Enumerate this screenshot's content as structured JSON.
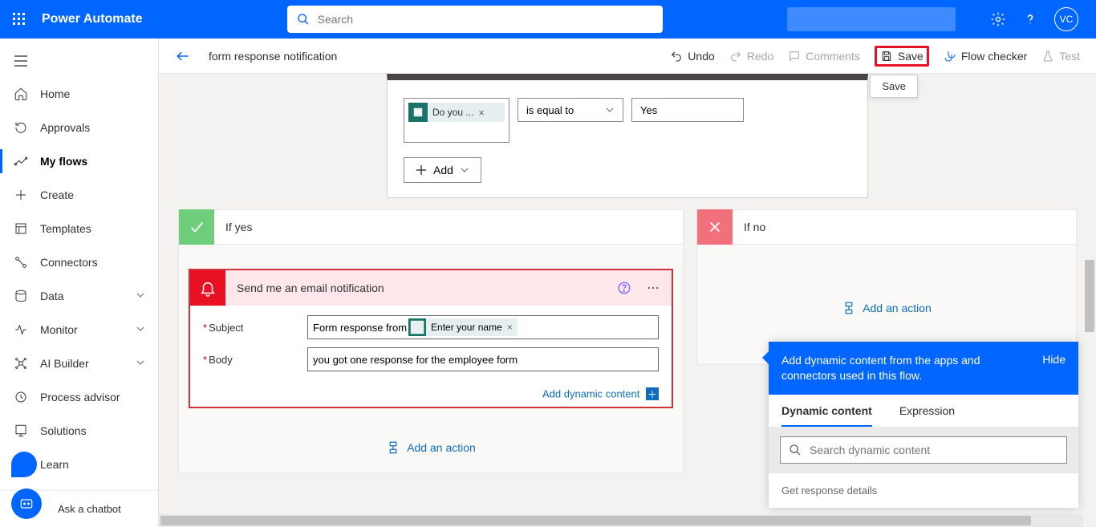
{
  "header": {
    "app_name": "Power Automate",
    "search_placeholder": "Search",
    "avatar_initials": "VC"
  },
  "sidebar": {
    "items": [
      {
        "label": "Home"
      },
      {
        "label": "Approvals"
      },
      {
        "label": "My flows"
      },
      {
        "label": "Create"
      },
      {
        "label": "Templates"
      },
      {
        "label": "Connectors"
      },
      {
        "label": "Data"
      },
      {
        "label": "Monitor"
      },
      {
        "label": "AI Builder"
      },
      {
        "label": "Process advisor"
      },
      {
        "label": "Solutions"
      },
      {
        "label": "Learn"
      }
    ],
    "chatbot_label": "Ask a chatbot"
  },
  "command_bar": {
    "flow_title": "form response notification",
    "undo": "Undo",
    "redo": "Redo",
    "comments": "Comments",
    "save": "Save",
    "flow_checker": "Flow checker",
    "test": "Test",
    "save_tooltip": "Save"
  },
  "condition": {
    "token_label": "Do you ...",
    "operator": "is equal to",
    "value": "Yes",
    "add_label": "Add"
  },
  "branches": {
    "yes_title": "If yes",
    "no_title": "If no",
    "add_action_label": "Add an action"
  },
  "action_card": {
    "title": "Send me an email notification",
    "fields": {
      "subject_label": "Subject",
      "subject_prefix": "Form response from",
      "subject_token": "Enter your name",
      "body_label": "Body",
      "body_value": "you got one response for the employee form"
    },
    "dynamic_link": "Add dynamic content"
  },
  "dynamic_panel": {
    "message": "Add dynamic content from the apps and connectors used in this flow.",
    "hide": "Hide",
    "tab_dynamic": "Dynamic content",
    "tab_expression": "Expression",
    "search_placeholder": "Search dynamic content",
    "section1": "Get response details"
  }
}
